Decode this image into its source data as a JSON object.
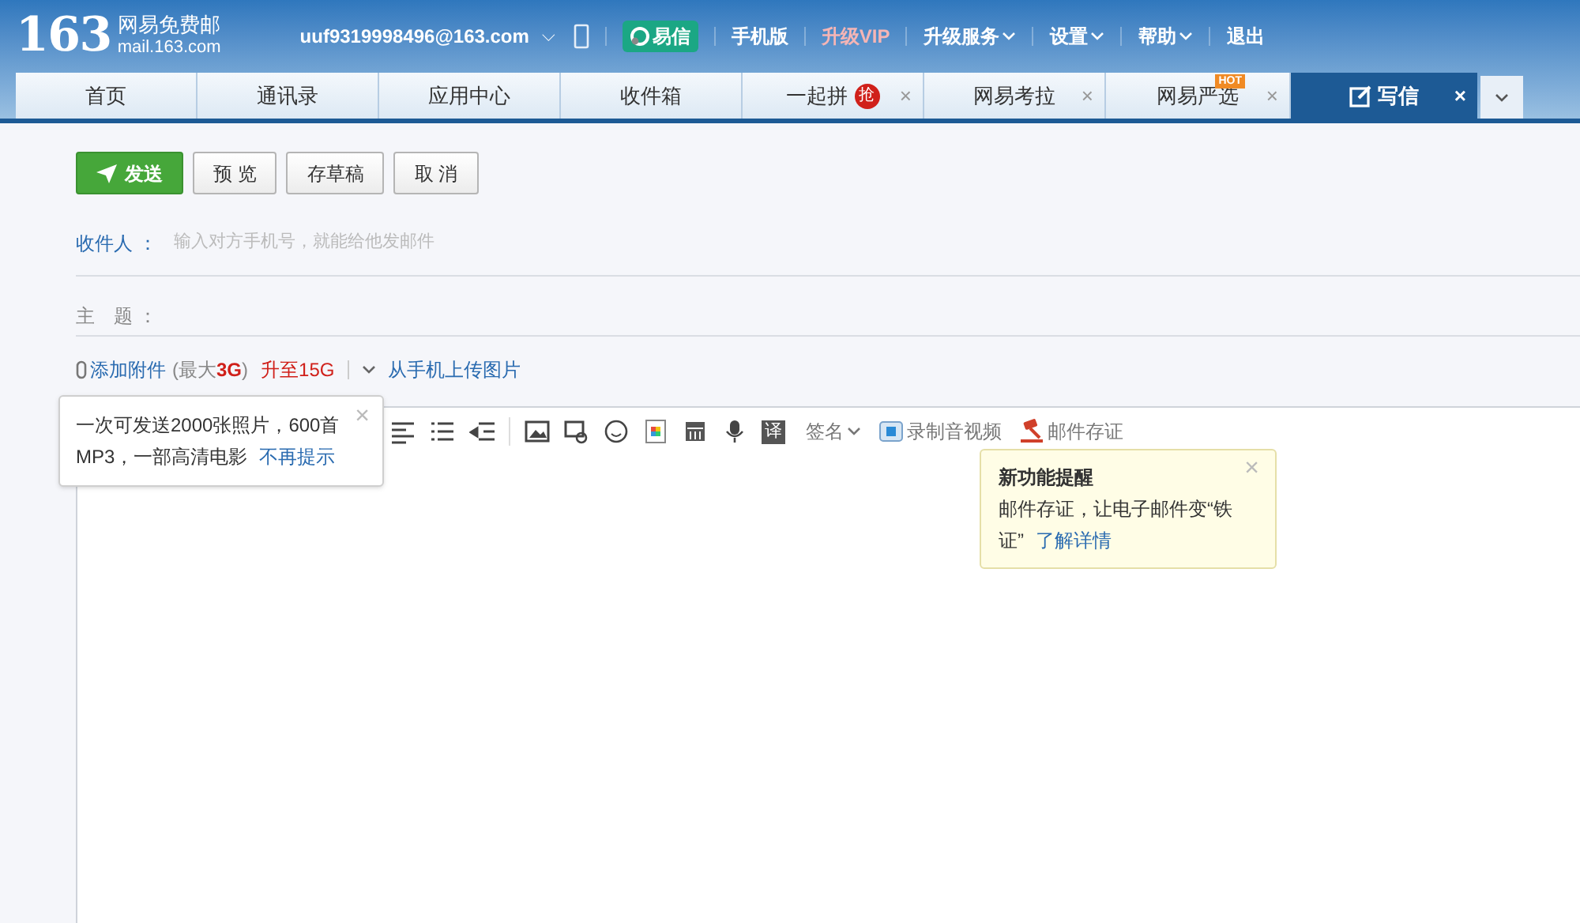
{
  "logo": {
    "number": "163",
    "name": "网易免费邮",
    "domain": "mail.163.com"
  },
  "account": {
    "email": "uuf9319998496@163.com",
    "caret": "⌵"
  },
  "top_links": [
    {
      "label": "易信",
      "kind": "yixin"
    },
    {
      "label": "手机版",
      "kind": "link"
    },
    {
      "label": "升级VIP",
      "kind": "vip"
    },
    {
      "label": "升级服务",
      "kind": "menu"
    },
    {
      "label": "设置",
      "kind": "menu"
    },
    {
      "label": "帮助",
      "kind": "menu"
    },
    {
      "label": "退出",
      "kind": "link"
    }
  ],
  "tabs": [
    {
      "label": "首页",
      "selected": false
    },
    {
      "label": "通讯录",
      "selected": false
    },
    {
      "label": "应用中心",
      "selected": false
    },
    {
      "label": "收件箱",
      "selected": false
    },
    {
      "label": "一起拼",
      "selected": false,
      "close": "×",
      "badge": {
        "kind": "circle",
        "text": "抢"
      }
    },
    {
      "label": "网易考拉",
      "selected": false,
      "close": "×"
    },
    {
      "label": "网易严选",
      "selected": false,
      "close": "×",
      "badge": {
        "kind": "tag",
        "text": "HOT"
      }
    },
    {
      "label": "写信",
      "selected": true,
      "close": "×",
      "kind": "compose"
    }
  ],
  "actions": [
    {
      "label": "发送",
      "kind": "primary"
    },
    {
      "label": "预 览",
      "kind": "default"
    },
    {
      "label": "存草稿",
      "kind": "default"
    },
    {
      "label": "取 消",
      "kind": "default"
    }
  ],
  "recipient": {
    "label": "收件人 ：",
    "placeholder": "输入对方手机号，就能给他发邮件"
  },
  "subject": {
    "label": "主　题 ："
  },
  "attach": {
    "add": "添加附件",
    "limit": "(最大**3G**)",
    "upgrade": "升至15G",
    "phone_upload": "从手机上传图片"
  },
  "attach_tip": {
    "text": "一次可发送2000张照片，600首MP3，一部高清电影",
    "link": "不再提示",
    "close": "×"
  },
  "toolbar": [
    {
      "kind": "align"
    },
    {
      "kind": "list"
    },
    {
      "kind": "outdent"
    },
    {
      "kind": "sep"
    },
    {
      "kind": "image"
    },
    {
      "kind": "screenshot"
    },
    {
      "kind": "emoji"
    },
    {
      "kind": "colors"
    },
    {
      "kind": "calendar"
    },
    {
      "kind": "mic"
    },
    {
      "kind": "char",
      "text": "译"
    },
    {
      "kind": "menu",
      "text": "签名"
    },
    {
      "kind": "video",
      "text": "录制音视频"
    },
    {
      "kind": "gavel",
      "text": "邮件存证"
    }
  ],
  "feature_tip": {
    "title": "新功能提醒",
    "text": "邮件存证，让电子邮件变“铁证”",
    "link": "了解详情",
    "close": "×"
  }
}
